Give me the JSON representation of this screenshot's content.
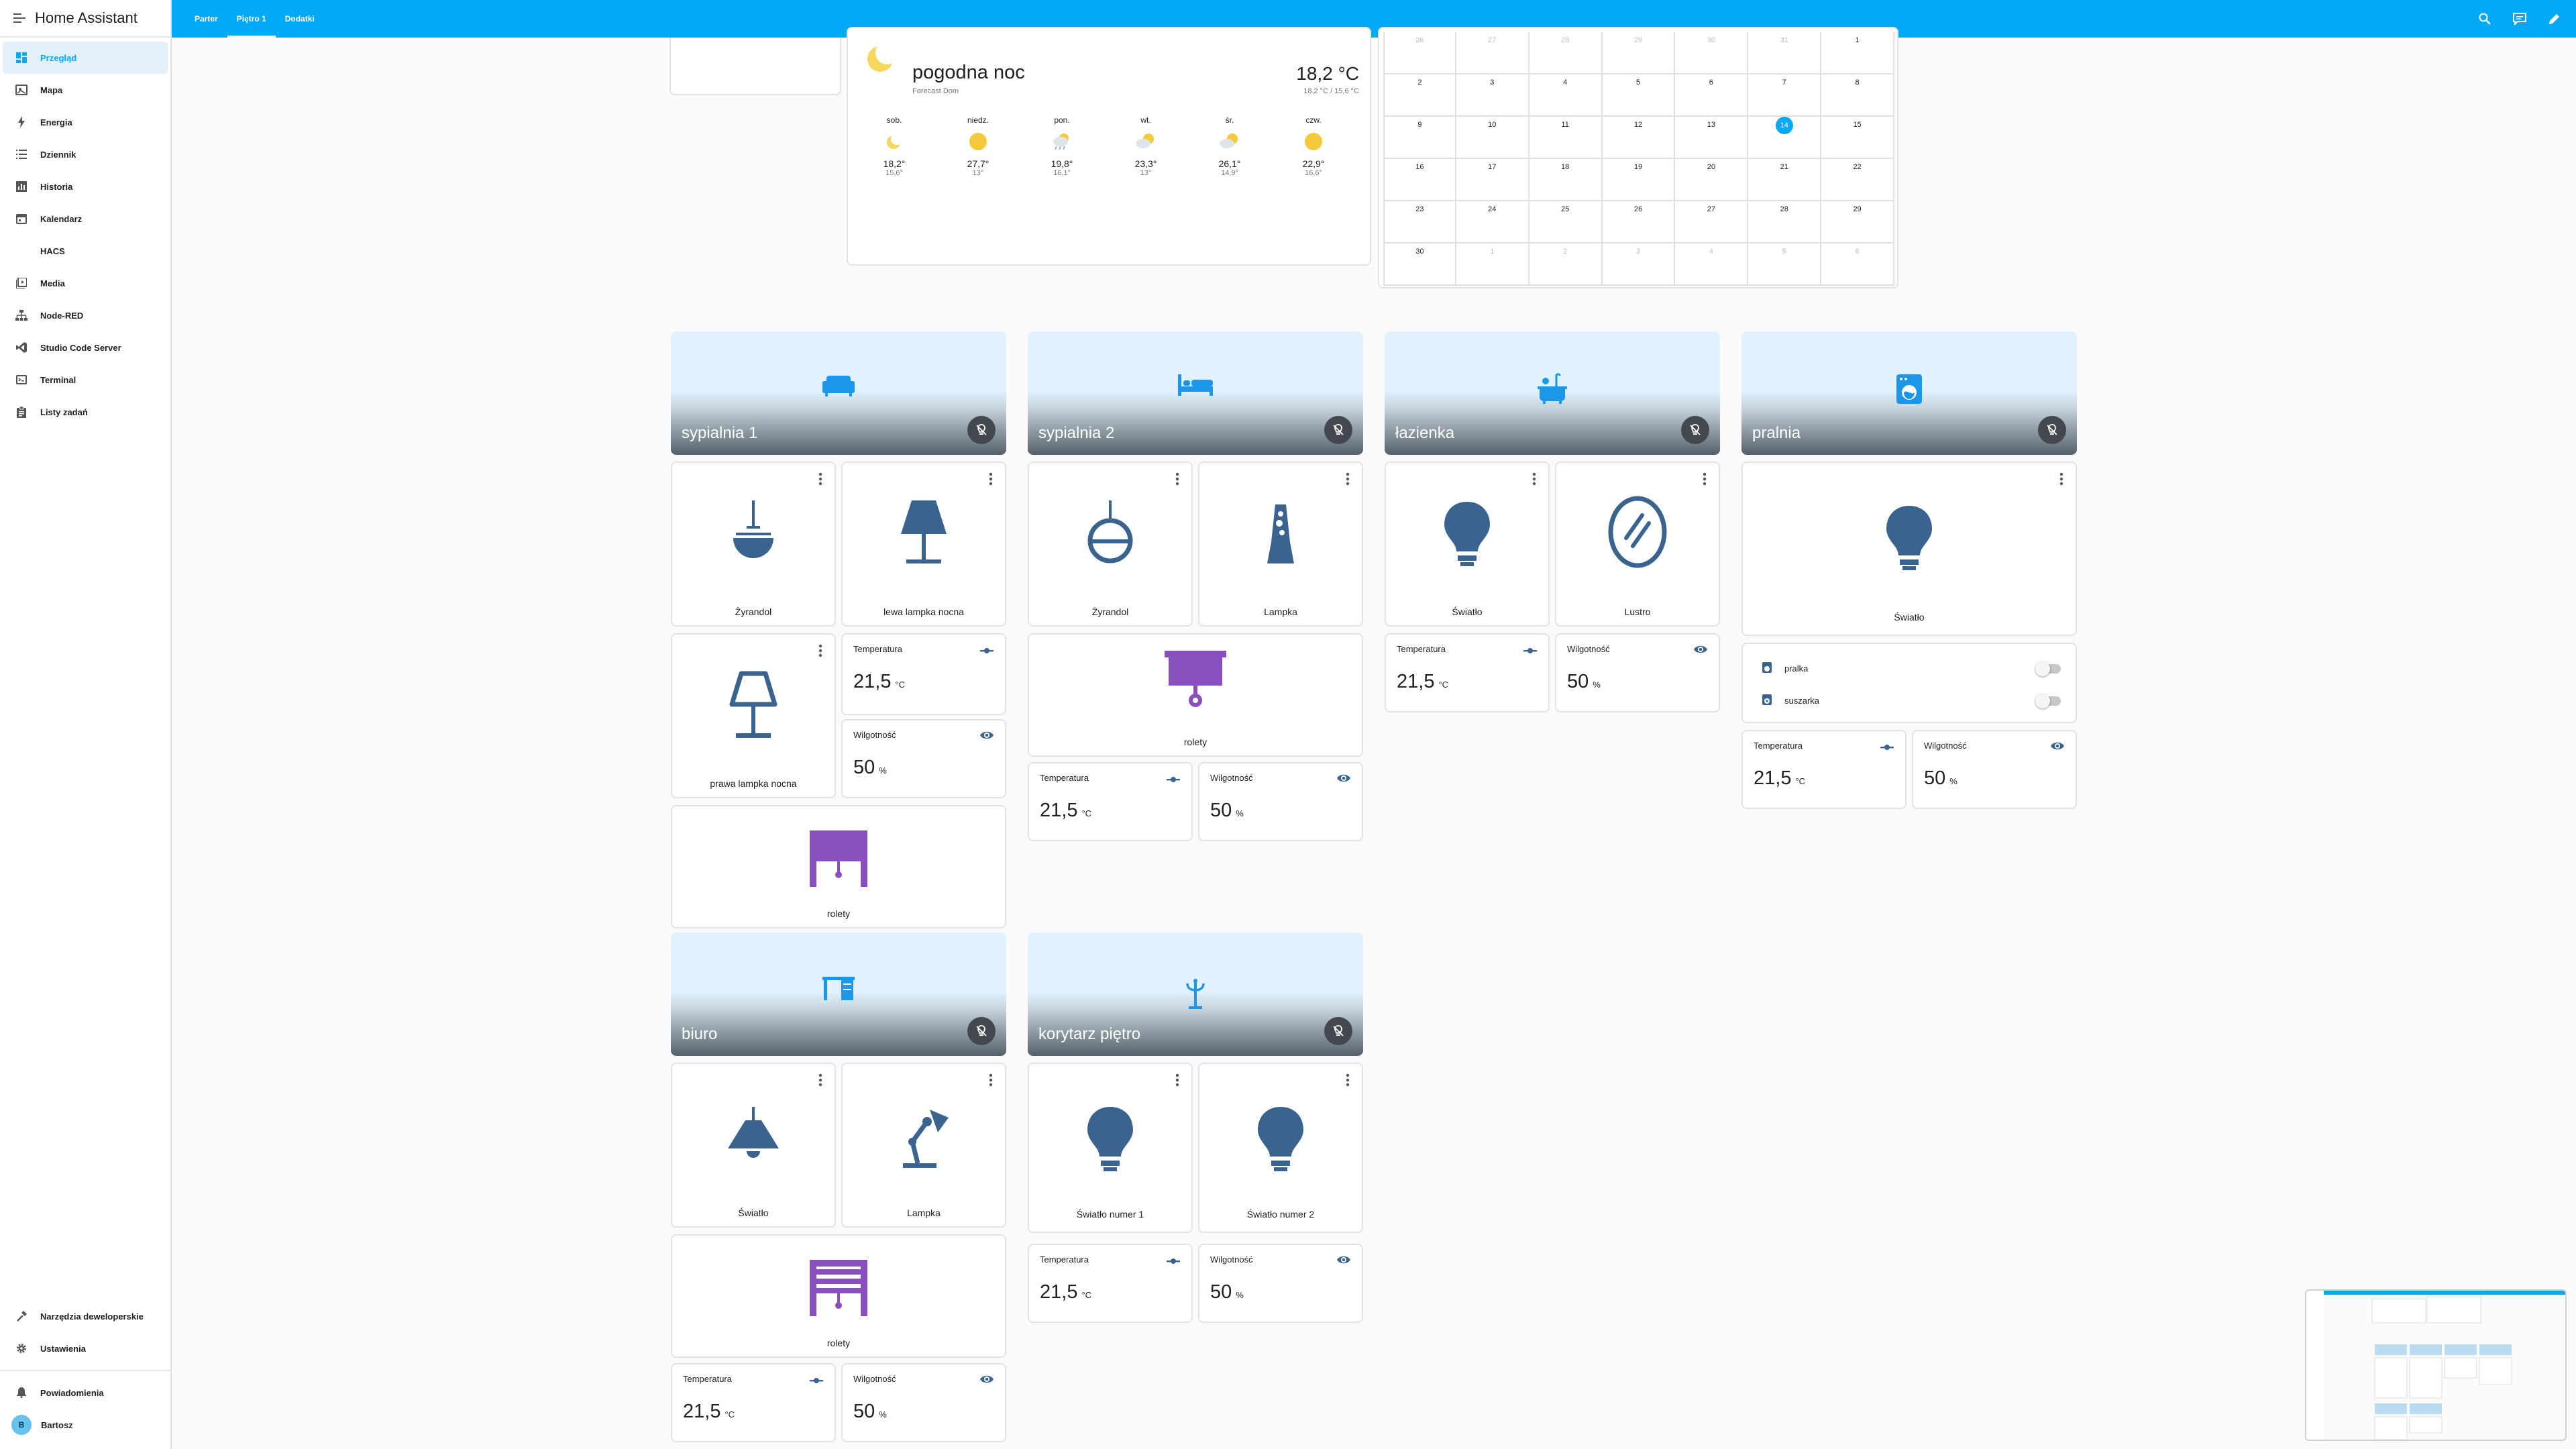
{
  "app": {
    "title": "Home Assistant"
  },
  "colors": {
    "primary": "#03a9f4",
    "icon_blue": "#3a648f",
    "icon_purple": "#8a4fbe",
    "toggle_off": "#c7c7c7"
  },
  "sidebar": {
    "items": [
      {
        "label": "Przegląd",
        "icon": "dashboard-icon",
        "active": true
      },
      {
        "label": "Mapa",
        "icon": "map-icon"
      },
      {
        "label": "Energia",
        "icon": "lightning-icon"
      },
      {
        "label": "Dziennik",
        "icon": "list-icon"
      },
      {
        "label": "Historia",
        "icon": "chart-icon"
      },
      {
        "label": "Kalendarz",
        "icon": "calendar-icon"
      },
      {
        "label": "HACS",
        "icon": "hacs-icon"
      },
      {
        "label": "Media",
        "icon": "media-icon"
      },
      {
        "label": "Node-RED",
        "icon": "sitemap-icon"
      },
      {
        "label": "Studio Code Server",
        "icon": "vscode-icon"
      },
      {
        "label": "Terminal",
        "icon": "terminal-icon"
      },
      {
        "label": "Listy zadań",
        "icon": "clipboard-icon"
      }
    ],
    "dev_tools": "Narzędzia deweloperskie",
    "settings": "Ustawienia",
    "notifications": "Powiadomienia",
    "user": {
      "initial": "B",
      "name": "Bartosz"
    }
  },
  "topbar": {
    "tabs": [
      {
        "label": "Parter"
      },
      {
        "label": "Piętro 1",
        "active": true
      },
      {
        "label": "Dodatki"
      }
    ],
    "icons": [
      "search-icon",
      "assist-icon",
      "edit-icon"
    ]
  },
  "weather": {
    "condition": "pogodna noc",
    "source": "Forecast Dom",
    "temp": "18,2 °C",
    "range": "18,2 °C / 15,6 °C",
    "forecast": [
      {
        "day": "sob.",
        "icon": "night-icon",
        "high": "18,2°",
        "low": "15,6°"
      },
      {
        "day": "niedz.",
        "icon": "sun-icon",
        "high": "27,7°",
        "low": "13°"
      },
      {
        "day": "pon.",
        "icon": "rain-icon",
        "high": "19,8°",
        "low": "16,1°"
      },
      {
        "day": "wt.",
        "icon": "partly-cloudy-icon",
        "high": "23,3°",
        "low": "13°"
      },
      {
        "day": "śr.",
        "icon": "partly-cloudy-icon",
        "high": "26,1°",
        "low": "14,9°"
      },
      {
        "day": "czw.",
        "icon": "sun-icon",
        "high": "22,9°",
        "low": "16,6°"
      }
    ]
  },
  "calendar": {
    "rows": [
      [
        "26",
        "27",
        "28",
        "29",
        "30",
        "31",
        "1"
      ],
      [
        "2",
        "3",
        "4",
        "5",
        "6",
        "7",
        "8"
      ],
      [
        "9",
        "10",
        "11",
        "12",
        "13",
        "14",
        "15"
      ],
      [
        "16",
        "17",
        "18",
        "19",
        "20",
        "21",
        "22"
      ],
      [
        "23",
        "24",
        "25",
        "26",
        "27",
        "28",
        "29"
      ],
      [
        "30",
        "1",
        "2",
        "3",
        "4",
        "5",
        "6"
      ]
    ],
    "today": "14"
  },
  "areas": {
    "sypialnia1": {
      "name": "sypialnia 1"
    },
    "sypialnia2": {
      "name": "sypialnia 2"
    },
    "lazienka": {
      "name": "łazienka"
    },
    "pralnia": {
      "name": "pralnia"
    },
    "biuro": {
      "name": "biuro"
    },
    "korytarz": {
      "name": "korytarz piętro"
    }
  },
  "devices": {
    "s1_zyrandol": "Żyrandol",
    "s1_lewa": "lewa lampka nocna",
    "s1_prawa": "prawa lampka nocna",
    "s1_rolety": "rolety",
    "s2_zyrandol": "Żyrandol",
    "s2_lampka": "Lampka",
    "s2_rolety": "rolety",
    "l_swiatlo": "Światło",
    "l_lustro": "Lustro",
    "p_swiatlo": "Światło",
    "p_pralka": "pralka",
    "p_suszarka": "suszarka",
    "b_swiatlo": "Światło",
    "b_lampka": "Lampka",
    "b_rolety": "rolety",
    "k_swiatlo1": "Światło numer 1",
    "k_swiatlo2": "Światło numer 2"
  },
  "sensors": {
    "temp_label": "Temperatura",
    "temp_value": "21,5",
    "temp_unit": "°C",
    "hum_label": "Wilgotność",
    "hum_value": "50",
    "hum_unit": "%"
  }
}
